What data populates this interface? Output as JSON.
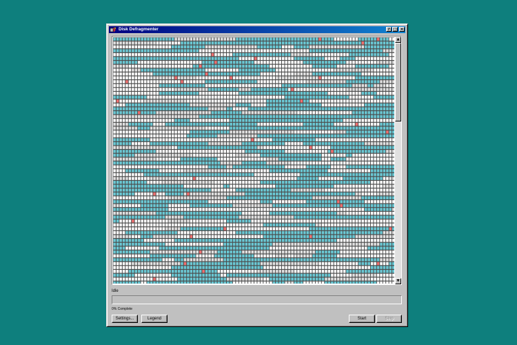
{
  "window": {
    "title": "Disk Defragmenter",
    "buttons": {
      "help": "?",
      "maximize": "□",
      "close": "×"
    }
  },
  "colors": {
    "desktop": "#0e7f7d",
    "fragmented_cluster": "#6ac8d4",
    "free_cluster": "#ffffff",
    "contiguous_cluster": "#e0e0e0",
    "grid_line": "#4b4b4b",
    "highlight_cluster": "#f07070"
  },
  "cluster_map": {
    "icon": "drive-cluster-map",
    "rows": 64,
    "cols": 92,
    "seed": 7
  },
  "status": {
    "label": "Idle",
    "progress_fraction": 0,
    "percent_text": "0% Complete"
  },
  "actions": {
    "settings": "Settings...",
    "legend": "Legend",
    "start": "Start",
    "stop": "Stop"
  },
  "icons": {
    "app": "defrag-app-icon",
    "scroll_up": "scroll-up-arrow-icon",
    "scroll_down": "scroll-down-arrow-icon"
  }
}
